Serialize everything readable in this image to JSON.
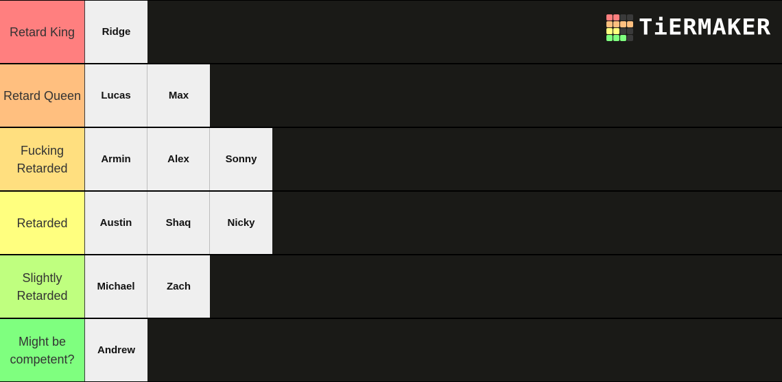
{
  "tiers": [
    {
      "label": "Retard King",
      "color": "#ff7f7f",
      "items": [
        "Ridge"
      ]
    },
    {
      "label": "Retard Queen",
      "color": "#ffbf7f",
      "items": [
        "Lucas",
        "Max"
      ]
    },
    {
      "label": "Fucking Retarded",
      "color": "#ffdf7f",
      "items": [
        "Armin",
        "Alex",
        "Sonny"
      ]
    },
    {
      "label": "Retarded",
      "color": "#ffff7f",
      "items": [
        "Austin",
        "Shaq",
        "Nicky"
      ]
    },
    {
      "label": "Slightly Retarded",
      "color": "#bfff7f",
      "items": [
        "Michael",
        "Zach"
      ]
    },
    {
      "label": "Might be competent?",
      "color": "#7fff7f",
      "items": [
        "Andrew"
      ]
    }
  ],
  "logo": {
    "text": "TiERMAKER",
    "icon": "tiermaker-grid-icon",
    "grid_colors": [
      "#ff7f7f",
      "#ff7f7f",
      "#3a3a3a",
      "#3a3a3a",
      "#ffbf7f",
      "#ffbf7f",
      "#ffbf7f",
      "#ffbf7f",
      "#ffff7f",
      "#ffff7f",
      "#3a3a3a",
      "#3a3a3a",
      "#7fff7f",
      "#7fff7f",
      "#7fff7f",
      "#3a3a3a"
    ]
  }
}
